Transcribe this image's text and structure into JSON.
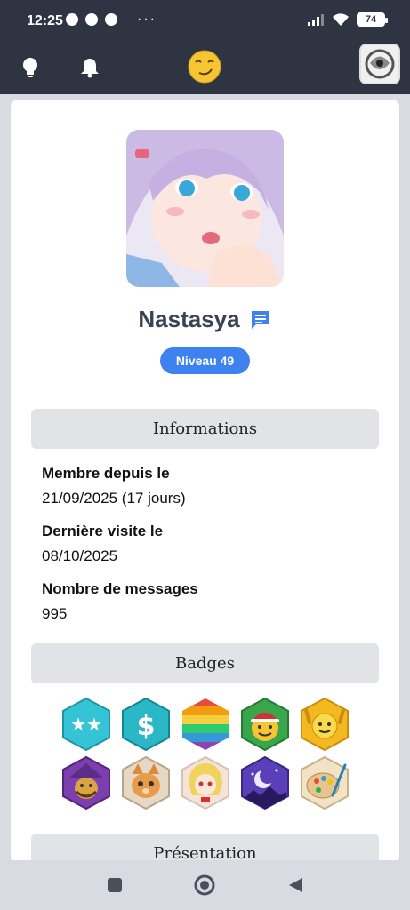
{
  "status_bar": {
    "time": "12:25",
    "battery": "74",
    "dots": "···"
  },
  "app_bar": {
    "icons": [
      "lightbulb-icon",
      "bell-icon",
      "smirk-emoji-icon",
      "user-avatar"
    ]
  },
  "profile": {
    "username": "Nastasya",
    "level": "Niveau 49"
  },
  "sections": {
    "informations": "Informations",
    "badges": "Badges",
    "presentation": "Présentation"
  },
  "info": {
    "member_since_label": "Membre depuis le",
    "member_since_value": "21/09/2025 (17 jours)",
    "last_visit_label": "Dernière visite le",
    "last_visit_value": "08/10/2025",
    "messages_label": "Nombre de messages",
    "messages_value": "995"
  },
  "badges": [
    {
      "name": "two-stars-badge",
      "color": "#35c4d6"
    },
    {
      "name": "dollar-badge",
      "color": "#2ab8c6"
    },
    {
      "name": "rainbow-badge",
      "color": "#f2a33a"
    },
    {
      "name": "santa-emoji-badge",
      "color": "#3aa64b"
    },
    {
      "name": "cheering-emoji-badge",
      "color": "#f4b821"
    },
    {
      "name": "wizard-badge",
      "color": "#7b3fb0"
    },
    {
      "name": "cat-badge",
      "color": "#e7d8c5"
    },
    {
      "name": "anime-girl-badge",
      "color": "#f3e3d8"
    },
    {
      "name": "moon-night-badge",
      "color": "#5b3fb8"
    },
    {
      "name": "paint-palette-badge",
      "color": "#f2e2c6"
    }
  ],
  "colors": {
    "app_bar": "#2f3443",
    "level_badge": "#3e82f0",
    "section_bg": "#e2e3e7",
    "page_bg": "#d9dbe2"
  }
}
